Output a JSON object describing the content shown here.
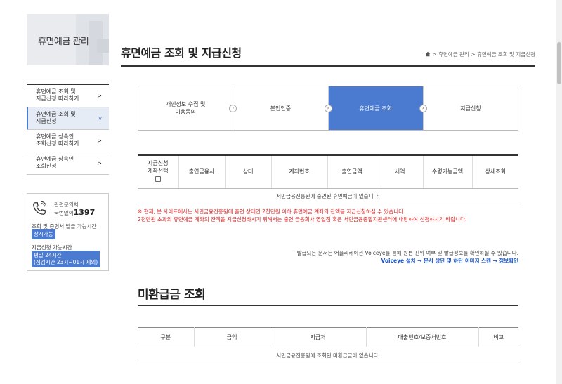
{
  "sidebar": {
    "title": "휴면예금 관리",
    "items": [
      {
        "line1": "휴면예금 조회 및",
        "line2": "지급신청 따라하기",
        "arrow": ">"
      },
      {
        "line1": "휴면예금 조회 및",
        "line2": "지급신청",
        "arrow": "v"
      },
      {
        "line1": "휴면예금 상속인",
        "line2": "조회신청 따라하기",
        "arrow": ">"
      },
      {
        "line1": "휴면예금 상속인",
        "line2": "조회신청",
        "arrow": ">"
      }
    ],
    "contact": {
      "label1": "관련문의처",
      "label2": "국번없이",
      "number": "1397",
      "inquiry_label": "조회 및 증명서 발급 가능시간",
      "inquiry_badge": "상시가능",
      "apply_label": "지급신청 가능시간",
      "apply_badge_line1": "평일 24시간",
      "apply_badge_line2": "(점검시간 23시~01시 제외)"
    }
  },
  "header": {
    "title": "휴면예금 조회 및 지급신청",
    "breadcrumb": [
      "휴면예금 관리",
      "휴면예금 조회 및 지급신청"
    ],
    "sep": ">"
  },
  "steps": [
    {
      "line1": "개인정보 수집 및",
      "line2": "이용동의"
    },
    {
      "line1": "본인인증",
      "line2": ""
    },
    {
      "line1": "휴면예금 조회",
      "line2": ""
    },
    {
      "line1": "지급신청",
      "line2": ""
    }
  ],
  "dormant_table": {
    "headers": [
      "지급신청\n계좌선택",
      "출연금융사",
      "상태",
      "계좌번호",
      "출연금액",
      "세액",
      "수령가능금액",
      "상세조회"
    ],
    "empty_message": "서민금융진흥원에 출연된 휴면예금이 없습니다."
  },
  "notice": {
    "line1": "※ 현재, 본 사이트에서는 서민금융진흥원에 출연 상태인 2천만원 이하 휴면예금 계좌의 잔액을 지급신청하실 수 있습니다.",
    "line2": "2천만원 초과의 휴면예금 계좌의 잔액을 지급신청하시기 위해서는 출연 금융회사 영업점 혹은 서민금융종합지원센터에 내방하여 신청하시기 바랍니다."
  },
  "issue": {
    "line1": "발급되는 문서는 어플리케이션 Voiceye를 통해 원본 진위 여부 및 발급정보를 확인하실 수 있습니다.",
    "line2": "Voiceye 설치 → 문서 상단 및 하단 이미지 스캔 → 정보확인"
  },
  "unreturned": {
    "title": "미환급금 조회",
    "headers": [
      "구분",
      "금액",
      "지급처",
      "대출번호/보증서번호",
      "비고"
    ],
    "empty_message": "서민금융진흥원에 조회된 미환급금이 없습니다."
  },
  "colors": {
    "accent": "#4a7bd0",
    "notice": "#e02020",
    "link": "#1a57c8"
  }
}
